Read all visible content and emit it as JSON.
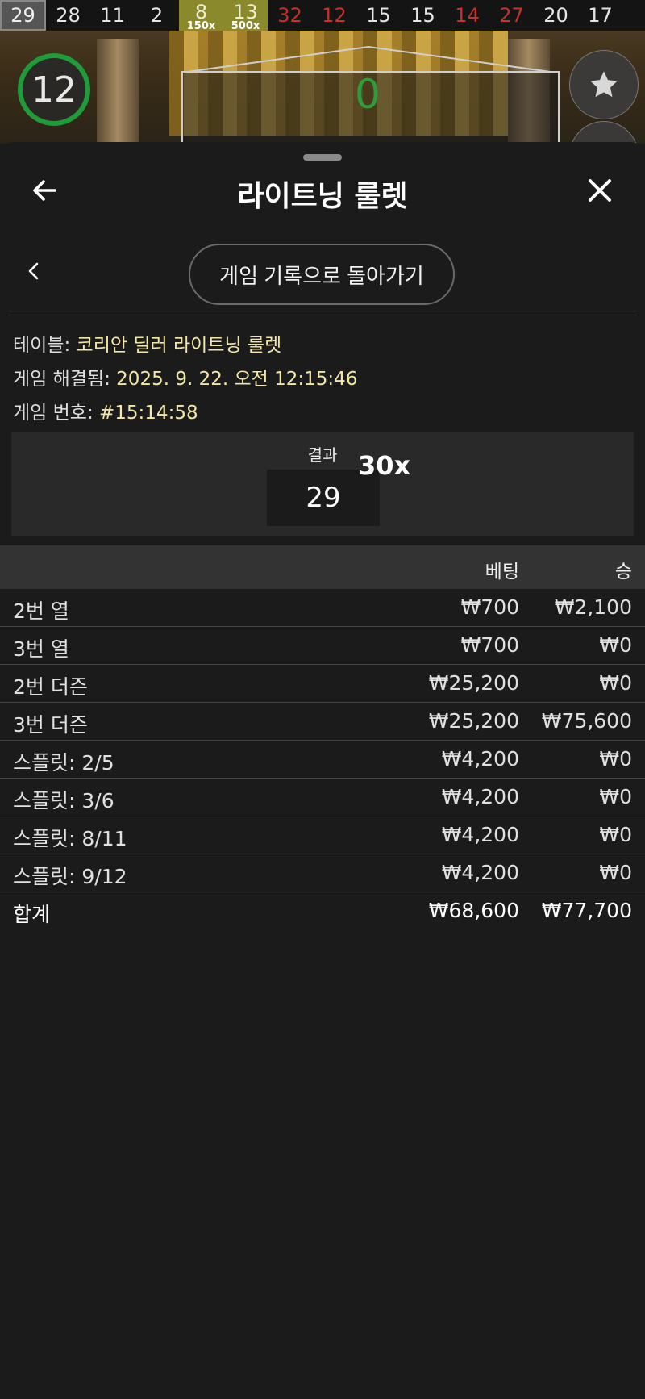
{
  "history": [
    {
      "value": "29",
      "kind": "current"
    },
    {
      "value": "28",
      "kind": "black"
    },
    {
      "value": "11",
      "kind": "black"
    },
    {
      "value": "2",
      "kind": "black"
    },
    {
      "value": "8",
      "kind": "gold",
      "multiplier": "150x"
    },
    {
      "value": "13",
      "kind": "gold",
      "multiplier": "500x"
    },
    {
      "value": "32",
      "kind": "red"
    },
    {
      "value": "12",
      "kind": "red"
    },
    {
      "value": "15",
      "kind": "black"
    },
    {
      "value": "15",
      "kind": "black"
    },
    {
      "value": "14",
      "kind": "red"
    },
    {
      "value": "27",
      "kind": "red"
    },
    {
      "value": "20",
      "kind": "black"
    },
    {
      "value": "17",
      "kind": "black"
    }
  ],
  "scene": {
    "timer": "12",
    "wheel_number": "0"
  },
  "header": {
    "title": "라이트닝 룰렛"
  },
  "back_to_history_label": "게임 기록으로 돌아가기",
  "info": {
    "table_label": "테이블: ",
    "table_value": "코리안 딜러 라이트닝 룰렛",
    "resolved_label": "게임 해결됨: ",
    "resolved_value": "2025. 9. 22. 오전 12:15:46",
    "number_label": "게임 번호: ",
    "number_value": "#15:14:58"
  },
  "result": {
    "label": "결과",
    "number": "29",
    "multiplier": "30x"
  },
  "table": {
    "headers": {
      "bet": "베팅",
      "win": "승"
    },
    "rows": [
      {
        "name": "2번 열",
        "bet": "₩700",
        "win": "₩2,100"
      },
      {
        "name": "3번 열",
        "bet": "₩700",
        "win": "₩0"
      },
      {
        "name": "2번 더즌",
        "bet": "₩25,200",
        "win": "₩0"
      },
      {
        "name": "3번 더즌",
        "bet": "₩25,200",
        "win": "₩75,600"
      },
      {
        "name": "스플릿: 2/5",
        "bet": "₩4,200",
        "win": "₩0"
      },
      {
        "name": "스플릿: 3/6",
        "bet": "₩4,200",
        "win": "₩0"
      },
      {
        "name": "스플릿: 8/11",
        "bet": "₩4,200",
        "win": "₩0"
      },
      {
        "name": "스플릿: 9/12",
        "bet": "₩4,200",
        "win": "₩0"
      }
    ],
    "total": {
      "name": "합계",
      "bet": "₩68,600",
      "win": "₩77,700"
    }
  },
  "colors": {
    "accent_value": "#f3e7a8",
    "red": "#c7302b",
    "gold": "#8a8a2c",
    "green": "#1f9b3a"
  }
}
